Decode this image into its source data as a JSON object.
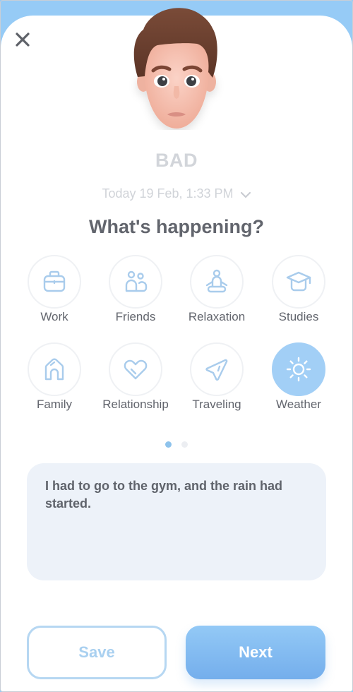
{
  "header": {
    "close_icon": "close-icon",
    "avatar": "sad-man-emoji-face"
  },
  "mood": {
    "label": "BAD"
  },
  "date": {
    "text": "Today 19 Feb, 1:33 PM",
    "icon": "chevron-down-icon"
  },
  "title": "What's happening?",
  "categories": [
    {
      "label": "Work",
      "icon": "briefcase-icon",
      "selected": false
    },
    {
      "label": "Friends",
      "icon": "people-icon",
      "selected": false
    },
    {
      "label": "Relaxation",
      "icon": "meditation-icon",
      "selected": false
    },
    {
      "label": "Studies",
      "icon": "graduation-cap-icon",
      "selected": false
    },
    {
      "label": "Family",
      "icon": "house-icon",
      "selected": false
    },
    {
      "label": "Relationship",
      "icon": "heart-icon",
      "selected": false
    },
    {
      "label": "Traveling",
      "icon": "paper-plane-icon",
      "selected": false
    },
    {
      "label": "Weather",
      "icon": "sun-icon",
      "selected": true
    }
  ],
  "pagination": {
    "pages": 2,
    "current": 1
  },
  "note": {
    "value": "I had to go to the gym, and the rain had started."
  },
  "buttons": {
    "save": "Save",
    "next": "Next"
  },
  "colors": {
    "accent": "#96cbf6",
    "selected_circle": "#a2cff6",
    "icon_stroke": "#a9ccec",
    "text_dark": "#62656d",
    "text_muted": "#d2d5da",
    "note_bg": "#edf2f9"
  }
}
